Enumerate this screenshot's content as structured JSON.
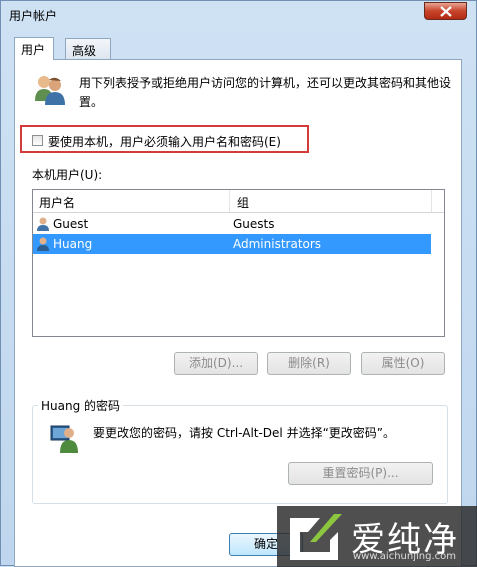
{
  "window": {
    "title": "用户帐户"
  },
  "tabs": [
    {
      "label": "用户",
      "active": true
    },
    {
      "label": "高级",
      "active": false
    }
  ],
  "intro_text": "用下列表授予或拒绝用户访问您的计算机，还可以更改其密码和其他设置。",
  "require_login_checkbox": {
    "label": "要使用本机，用户必须输入用户名和密码(E)",
    "checked": false
  },
  "local_users": {
    "label": "本机用户(U):",
    "columns": [
      "用户名",
      "组"
    ],
    "rows": [
      {
        "name": "Guest",
        "group": "Guests",
        "selected": false
      },
      {
        "name": "Huang",
        "group": "Administrators",
        "selected": true
      }
    ]
  },
  "buttons": {
    "add": "添加(D)...",
    "remove": "删除(R)",
    "properties": "属性(O)"
  },
  "password_group": {
    "title": "Huang 的密码",
    "text": "要更改您的密码，请按 Ctrl-Alt-Del 并选择“更改密码”。",
    "reset_button": "重置密码(P)..."
  },
  "footer": {
    "ok_button": "确定"
  },
  "watermark": {
    "name": "爱纯净",
    "url": "www.aichunjing.com"
  },
  "colors": {
    "selection": "#3399ff",
    "highlight_border": "#d33b3b"
  }
}
